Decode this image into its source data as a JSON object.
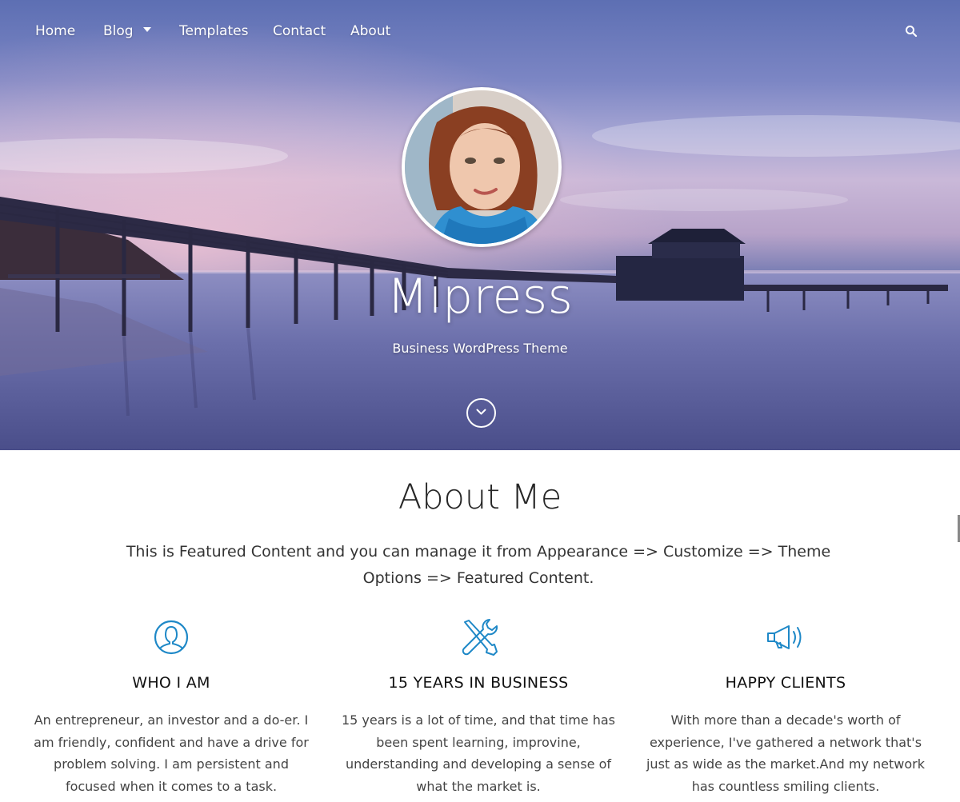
{
  "nav": {
    "items": [
      "Home",
      "Blog",
      "Templates",
      "Contact",
      "About"
    ],
    "search_icon": "search-icon"
  },
  "hero": {
    "title": "Mipress",
    "tagline": "Business WordPress Theme",
    "scroll_icon": "chevron-down-icon"
  },
  "about": {
    "title": "About Me",
    "description": "This is Featured Content and you can manage it from Appearance => Customize => Theme Options => Featured Content.",
    "features": [
      {
        "icon": "user-icon",
        "title": "WHO I AM",
        "text": "An entrepreneur, an investor and a do-er. I am friendly, confident and have a drive for problem solving. I am persistent and focused when it comes to a task."
      },
      {
        "icon": "tools-icon",
        "title": "15 YEARS IN BUSINESS",
        "text": "15 years is a lot of time, and that time has been spent learning, improvine, understanding and developing a sense of what the market is."
      },
      {
        "icon": "megaphone-icon",
        "title": "HAPPY CLIENTS",
        "text": "With more than a decade's worth of experience, I've gathered a network that's just as wide as the market.And my network has countless smiling clients."
      }
    ]
  },
  "colors": {
    "accent": "#1e88c7",
    "heading": "#111111"
  }
}
